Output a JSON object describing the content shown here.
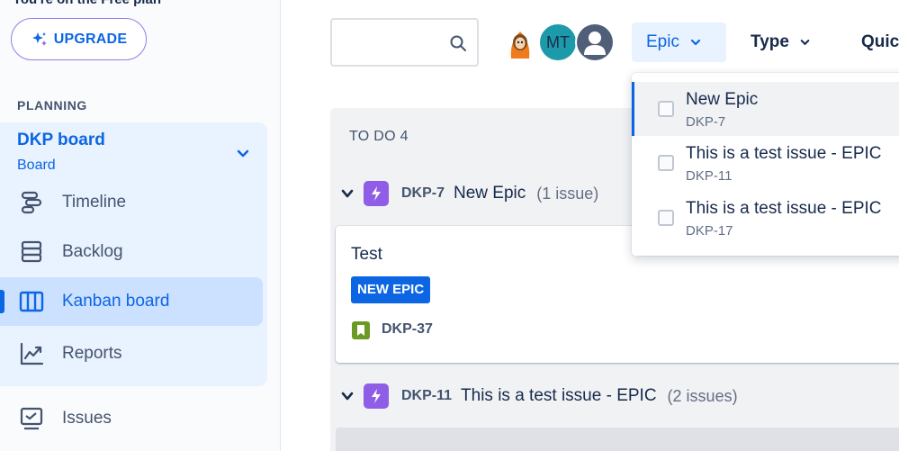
{
  "sidebar": {
    "plan_note": "You're on the Free plan",
    "upgrade_label": "UPGRADE",
    "section_heading": "PLANNING",
    "board": {
      "title": "DKP board",
      "subtitle": "Board"
    },
    "items": [
      {
        "label": "Timeline",
        "icon": "timeline-icon"
      },
      {
        "label": "Backlog",
        "icon": "backlog-icon"
      },
      {
        "label": "Kanban board",
        "icon": "kanban-board-icon",
        "active": true
      },
      {
        "label": "Reports",
        "icon": "reports-icon"
      }
    ],
    "issues_label": "Issues"
  },
  "toolbar": {
    "search_value": "",
    "avatars": [
      {
        "type": "illustration",
        "icon": "character-avatar"
      },
      {
        "type": "initials",
        "initials": "MT",
        "color": "#1d9aaa"
      },
      {
        "type": "placeholder",
        "icon": "user-icon"
      }
    ],
    "filters": {
      "epic": "Epic",
      "type": "Type",
      "quick": "Quic"
    }
  },
  "board": {
    "column": {
      "name": "TO DO",
      "count": "4"
    },
    "groups": [
      {
        "key": "DKP-7",
        "name": "New Epic",
        "count": "(1 issue)"
      },
      {
        "key": "DKP-11",
        "name": "This is a test issue - EPIC",
        "count": "(2 issues)"
      }
    ],
    "card": {
      "title": "Test",
      "epic_label": "NEW EPIC",
      "key": "DKP-37",
      "issue_type": "story"
    }
  },
  "epic_dropdown": {
    "items": [
      {
        "name": "New Epic",
        "key": "DKP-7",
        "checked": false
      },
      {
        "name": "This is a test issue - EPIC",
        "key": "DKP-11",
        "checked": false
      },
      {
        "name": "This is a test issue - EPIC",
        "key": "DKP-17",
        "checked": false
      }
    ]
  },
  "colors": {
    "accent": "#0c66e4",
    "epic_purple": "#8f5de6",
    "story_green": "#6a9a23",
    "selected_bg": "#e9f2ff"
  }
}
